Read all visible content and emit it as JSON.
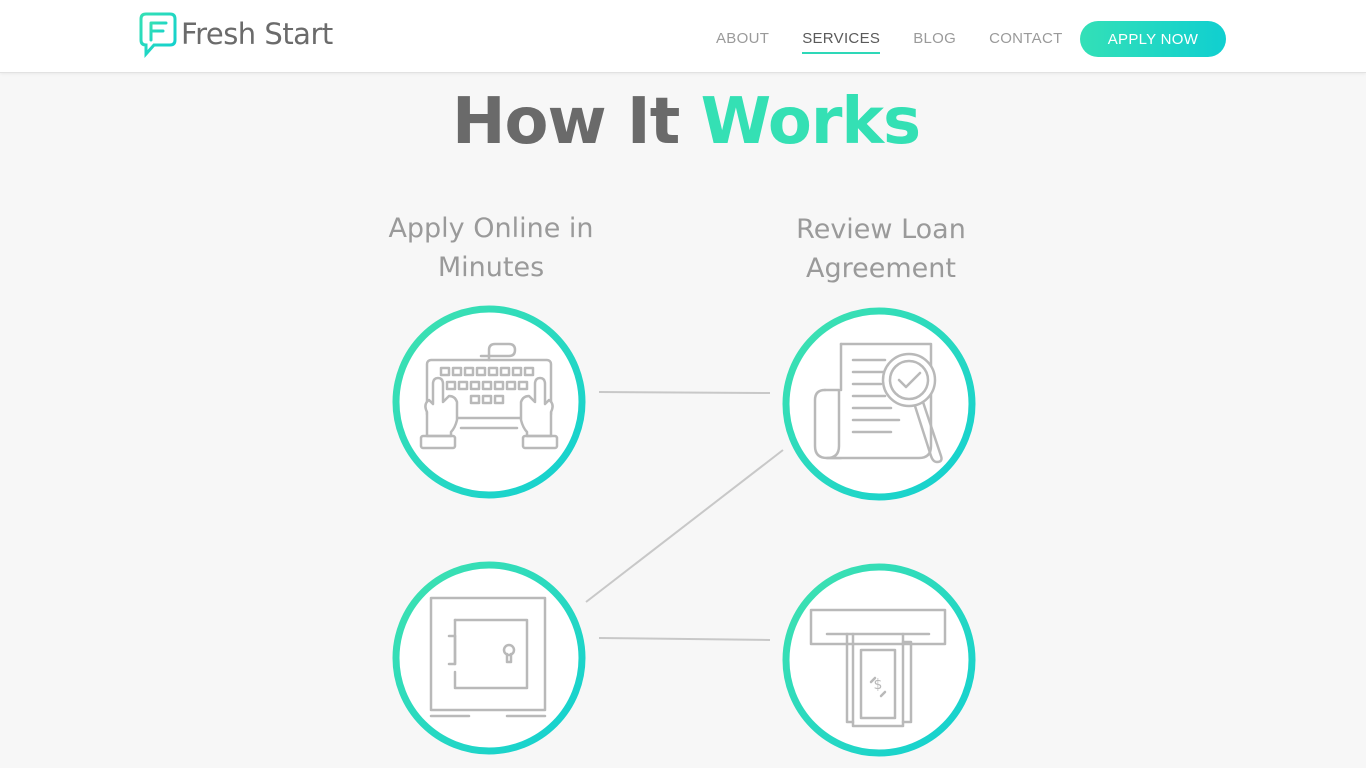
{
  "brand": {
    "name": "Fresh Start"
  },
  "nav": {
    "items": [
      {
        "label": "ABOUT",
        "active": false
      },
      {
        "label": "SERVICES",
        "active": true
      },
      {
        "label": "BLOG",
        "active": false
      },
      {
        "label": "CONTACT",
        "active": false
      }
    ],
    "apply_label": "APPLY NOW"
  },
  "hero": {
    "title_prefix": "How It",
    "title_accent": "Works"
  },
  "steps": [
    {
      "label_line1": "Apply Online in",
      "label_line2": "Minutes",
      "icon": "keyboard-typing-icon"
    },
    {
      "label_line1": "Review Loan",
      "label_line2": "Agreement",
      "icon": "document-magnifier-icon"
    },
    {
      "icon": "safe-vault-icon"
    },
    {
      "icon": "atm-cash-icon"
    }
  ],
  "colors": {
    "accent": "#34e0b4",
    "accent_teal": "#10cfd0",
    "text_gray": "#6a6a6a",
    "light_gray": "#9a9a9a",
    "background": "#f7f7f7"
  }
}
